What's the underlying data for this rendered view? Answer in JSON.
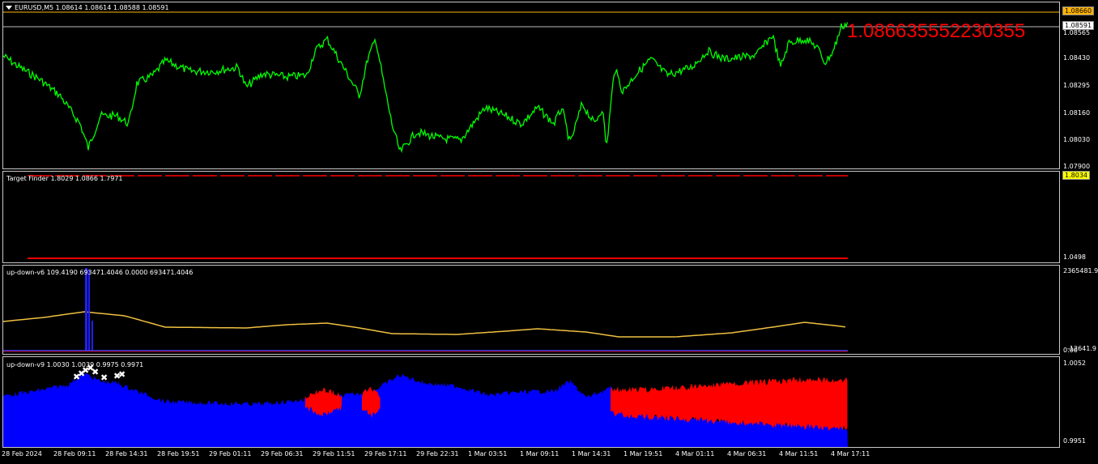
{
  "main": {
    "symbol_label": "EURUSD,M5  1.08614 1.08614 1.08588 1.08591",
    "big_price": "1.086635552230355",
    "current_price_tag": "1.08591",
    "high_price_tag": "1.08660",
    "scale_ticks": [
      "1.08565",
      "1.08430",
      "1.08295",
      "1.08160",
      "1.08030",
      "1.07900"
    ],
    "colors": {
      "price_line": "#00ff00",
      "big_price": "#ff0000",
      "hline": "#ffb300"
    }
  },
  "target_finder": {
    "label": "Target Finder 1.8029 1.0866 1.7971",
    "top_tag": "1.8034",
    "bottom_tick": "1.0498"
  },
  "updown_v6": {
    "label": "up-down-v6 109.4190 693471.4046 0.0000 693471.4046",
    "top_tick": "2365481.9",
    "bottom_tick_a": "0.00",
    "bottom_tick_b": "-12641.9"
  },
  "updown_v9": {
    "label": "up-down-v9 1.0030 1.0039 0.9975 0.9971",
    "top_tick": "1.0052",
    "bottom_tick": "0.9951"
  },
  "time_axis": [
    "28 Feb 2024",
    "28 Feb 09:11",
    "28 Feb 14:31",
    "28 Feb 19:51",
    "29 Feb 01:11",
    "29 Feb 06:31",
    "29 Feb 11:51",
    "29 Feb 17:11",
    "29 Feb 22:31",
    "1 Mar 03:51",
    "1 Mar 09:11",
    "1 Mar 14:31",
    "1 Mar 19:51",
    "4 Mar 01:11",
    "4 Mar 06:31",
    "4 Mar 11:51",
    "4 Mar 17:11"
  ]
}
